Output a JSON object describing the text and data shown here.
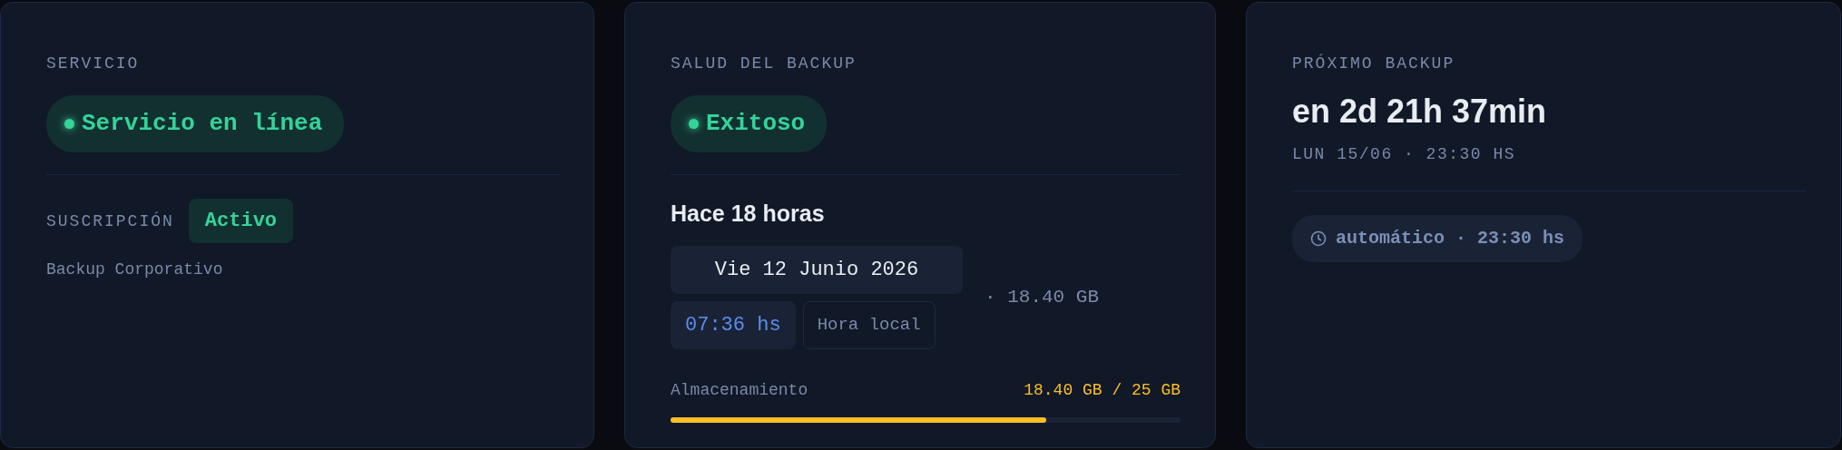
{
  "cards": [
    {
      "kind": "service",
      "label": "SERVICIO",
      "status": {
        "text": "Servicio en línea",
        "healthy": true
      },
      "subscription": {
        "label": "SUSCRIPCIÓN",
        "badge": "Activo",
        "healthy": true
      },
      "plan": "Backup Corporativo"
    },
    {
      "kind": "health",
      "label": "SALUD DEL BACKUP",
      "status": {
        "text": "Exitoso",
        "healthy": true
      },
      "ago": "Hace 18 horas",
      "date": "Vie 12 Junio 2026",
      "time": "07:36 hs",
      "time_note": "Hora local",
      "size": "· 18.40 GB",
      "storage": {
        "label": "Almacenamiento",
        "reading": "18.40 GB / 25 GB",
        "level": 0.736
      }
    },
    {
      "kind": "next",
      "label": "PRÓXIMO BACKUP",
      "countdown": "en 2d 21h 37min",
      "when": "LUN 15/06 · 23:30 HS",
      "schedule": "automático · 23:30 hs"
    }
  ]
}
